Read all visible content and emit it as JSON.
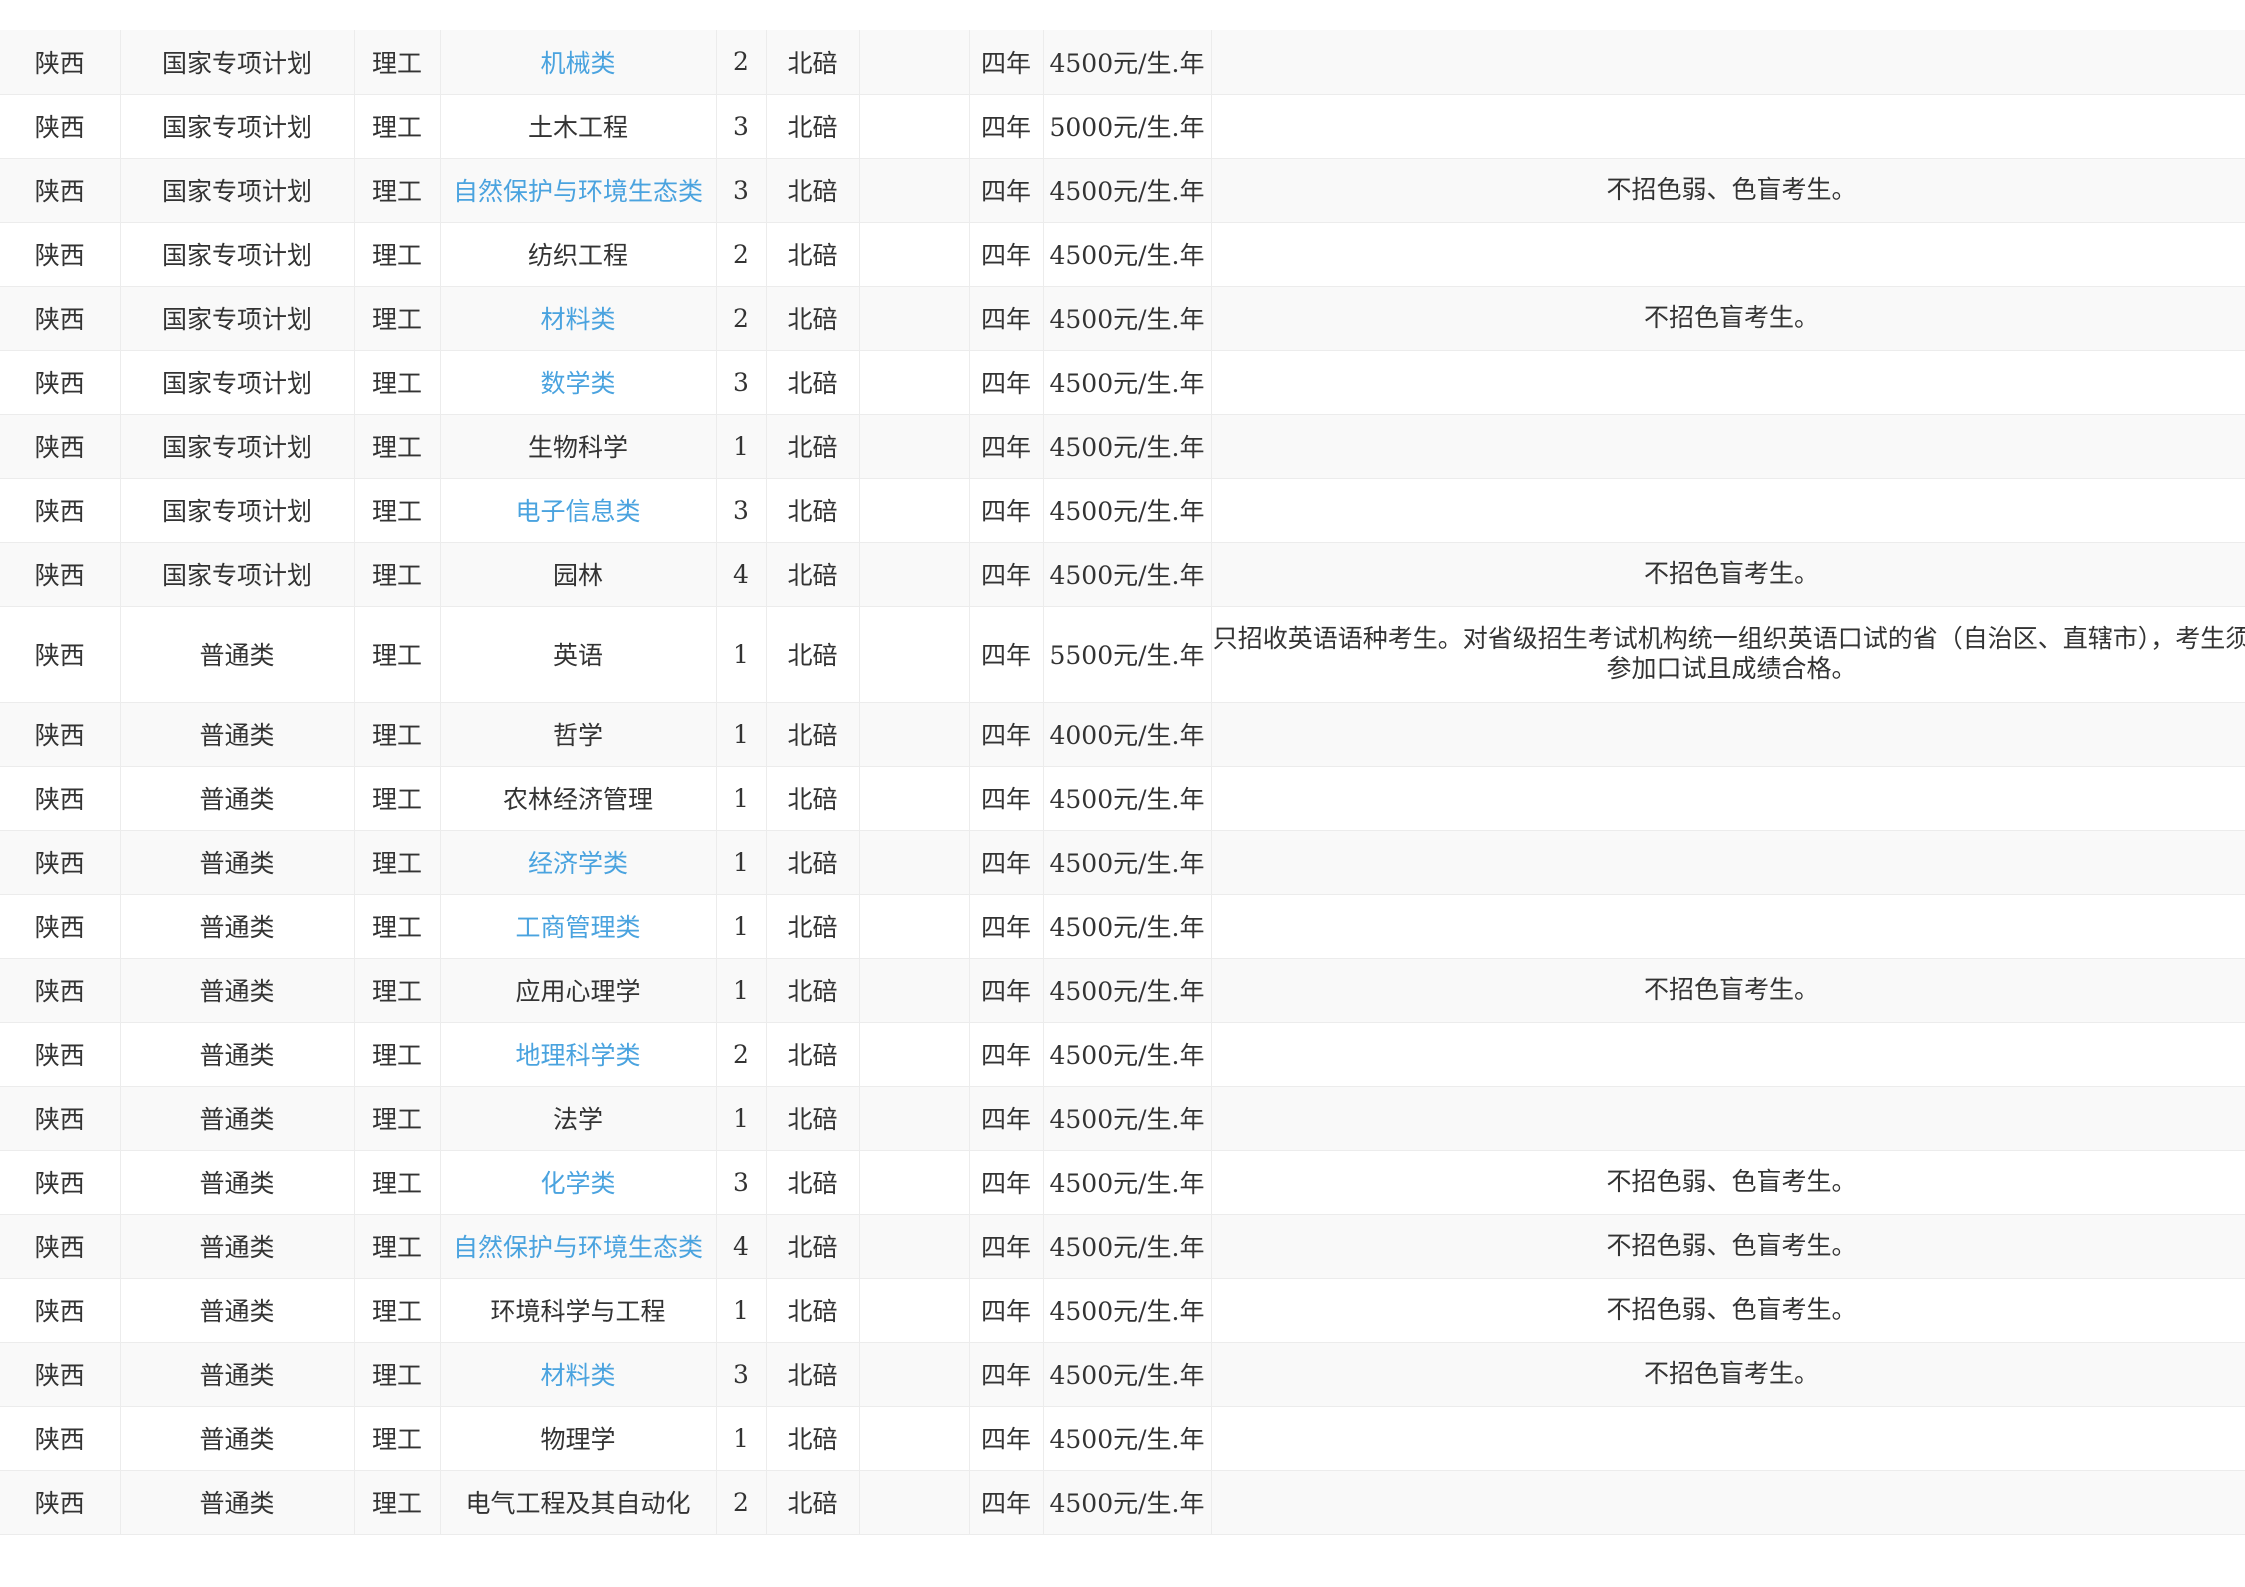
{
  "colors": {
    "link": "#4aa3df",
    "text": "#333333",
    "row_alt": "#f9f9f9",
    "border": "#ececec"
  },
  "rows": [
    {
      "province": "陕西",
      "plan": "国家专项计划",
      "subject": "理工",
      "major": "机械类",
      "major_is_link": true,
      "count": "2",
      "campus": "北碚",
      "extra": "",
      "duration": "四年",
      "fee": "4500元/生.年",
      "note": ""
    },
    {
      "province": "陕西",
      "plan": "国家专项计划",
      "subject": "理工",
      "major": "土木工程",
      "major_is_link": false,
      "count": "3",
      "campus": "北碚",
      "extra": "",
      "duration": "四年",
      "fee": "5000元/生.年",
      "note": ""
    },
    {
      "province": "陕西",
      "plan": "国家专项计划",
      "subject": "理工",
      "major": "自然保护与环境生态类",
      "major_is_link": true,
      "count": "3",
      "campus": "北碚",
      "extra": "",
      "duration": "四年",
      "fee": "4500元/生.年",
      "note": "不招色弱、色盲考生。"
    },
    {
      "province": "陕西",
      "plan": "国家专项计划",
      "subject": "理工",
      "major": "纺织工程",
      "major_is_link": false,
      "count": "2",
      "campus": "北碚",
      "extra": "",
      "duration": "四年",
      "fee": "4500元/生.年",
      "note": ""
    },
    {
      "province": "陕西",
      "plan": "国家专项计划",
      "subject": "理工",
      "major": "材料类",
      "major_is_link": true,
      "count": "2",
      "campus": "北碚",
      "extra": "",
      "duration": "四年",
      "fee": "4500元/生.年",
      "note": "不招色盲考生。"
    },
    {
      "province": "陕西",
      "plan": "国家专项计划",
      "subject": "理工",
      "major": "数学类",
      "major_is_link": true,
      "count": "3",
      "campus": "北碚",
      "extra": "",
      "duration": "四年",
      "fee": "4500元/生.年",
      "note": ""
    },
    {
      "province": "陕西",
      "plan": "国家专项计划",
      "subject": "理工",
      "major": "生物科学",
      "major_is_link": false,
      "count": "1",
      "campus": "北碚",
      "extra": "",
      "duration": "四年",
      "fee": "4500元/生.年",
      "note": ""
    },
    {
      "province": "陕西",
      "plan": "国家专项计划",
      "subject": "理工",
      "major": "电子信息类",
      "major_is_link": true,
      "count": "3",
      "campus": "北碚",
      "extra": "",
      "duration": "四年",
      "fee": "4500元/生.年",
      "note": ""
    },
    {
      "province": "陕西",
      "plan": "国家专项计划",
      "subject": "理工",
      "major": "园林",
      "major_is_link": false,
      "count": "4",
      "campus": "北碚",
      "extra": "",
      "duration": "四年",
      "fee": "4500元/生.年",
      "note": "不招色盲考生。"
    },
    {
      "province": "陕西",
      "plan": "普通类",
      "subject": "理工",
      "major": "英语",
      "major_is_link": false,
      "count": "1",
      "campus": "北碚",
      "extra": "",
      "duration": "四年",
      "fee": "5500元/生.年",
      "note": "只招收英语语种考生。对省级招生考试机构统一组织英语口试的省（自治区、直辖市），考生须参加口试且成绩合格。",
      "tall": true
    },
    {
      "province": "陕西",
      "plan": "普通类",
      "subject": "理工",
      "major": "哲学",
      "major_is_link": false,
      "count": "1",
      "campus": "北碚",
      "extra": "",
      "duration": "四年",
      "fee": "4000元/生.年",
      "note": ""
    },
    {
      "province": "陕西",
      "plan": "普通类",
      "subject": "理工",
      "major": "农林经济管理",
      "major_is_link": false,
      "count": "1",
      "campus": "北碚",
      "extra": "",
      "duration": "四年",
      "fee": "4500元/生.年",
      "note": ""
    },
    {
      "province": "陕西",
      "plan": "普通类",
      "subject": "理工",
      "major": "经济学类",
      "major_is_link": true,
      "count": "1",
      "campus": "北碚",
      "extra": "",
      "duration": "四年",
      "fee": "4500元/生.年",
      "note": ""
    },
    {
      "province": "陕西",
      "plan": "普通类",
      "subject": "理工",
      "major": "工商管理类",
      "major_is_link": true,
      "count": "1",
      "campus": "北碚",
      "extra": "",
      "duration": "四年",
      "fee": "4500元/生.年",
      "note": ""
    },
    {
      "province": "陕西",
      "plan": "普通类",
      "subject": "理工",
      "major": "应用心理学",
      "major_is_link": false,
      "count": "1",
      "campus": "北碚",
      "extra": "",
      "duration": "四年",
      "fee": "4500元/生.年",
      "note": "不招色盲考生。"
    },
    {
      "province": "陕西",
      "plan": "普通类",
      "subject": "理工",
      "major": "地理科学类",
      "major_is_link": true,
      "count": "2",
      "campus": "北碚",
      "extra": "",
      "duration": "四年",
      "fee": "4500元/生.年",
      "note": ""
    },
    {
      "province": "陕西",
      "plan": "普通类",
      "subject": "理工",
      "major": "法学",
      "major_is_link": false,
      "count": "1",
      "campus": "北碚",
      "extra": "",
      "duration": "四年",
      "fee": "4500元/生.年",
      "note": ""
    },
    {
      "province": "陕西",
      "plan": "普通类",
      "subject": "理工",
      "major": "化学类",
      "major_is_link": true,
      "count": "3",
      "campus": "北碚",
      "extra": "",
      "duration": "四年",
      "fee": "4500元/生.年",
      "note": "不招色弱、色盲考生。"
    },
    {
      "province": "陕西",
      "plan": "普通类",
      "subject": "理工",
      "major": "自然保护与环境生态类",
      "major_is_link": true,
      "count": "4",
      "campus": "北碚",
      "extra": "",
      "duration": "四年",
      "fee": "4500元/生.年",
      "note": "不招色弱、色盲考生。"
    },
    {
      "province": "陕西",
      "plan": "普通类",
      "subject": "理工",
      "major": "环境科学与工程",
      "major_is_link": false,
      "count": "1",
      "campus": "北碚",
      "extra": "",
      "duration": "四年",
      "fee": "4500元/生.年",
      "note": "不招色弱、色盲考生。"
    },
    {
      "province": "陕西",
      "plan": "普通类",
      "subject": "理工",
      "major": "材料类",
      "major_is_link": true,
      "count": "3",
      "campus": "北碚",
      "extra": "",
      "duration": "四年",
      "fee": "4500元/生.年",
      "note": "不招色盲考生。"
    },
    {
      "province": "陕西",
      "plan": "普通类",
      "subject": "理工",
      "major": "物理学",
      "major_is_link": false,
      "count": "1",
      "campus": "北碚",
      "extra": "",
      "duration": "四年",
      "fee": "4500元/生.年",
      "note": ""
    },
    {
      "province": "陕西",
      "plan": "普通类",
      "subject": "理工",
      "major": "电气工程及其自动化",
      "major_is_link": false,
      "count": "2",
      "campus": "北碚",
      "extra": "",
      "duration": "四年",
      "fee": "4500元/生.年",
      "note": ""
    }
  ]
}
